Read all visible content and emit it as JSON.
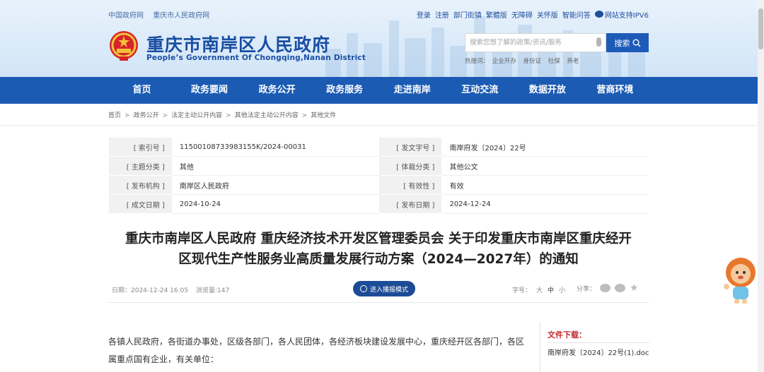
{
  "top_links": [
    "中国政府网",
    "重庆市人民政府网"
  ],
  "right_links": [
    "登录",
    "注册",
    "部门街镇",
    "繁體版",
    "无障碍",
    "关怀版",
    "智能问答",
    "网站支持IPV6"
  ],
  "site": {
    "title": "重庆市南岸区人民政府",
    "subtitle": "People’s Government Of Chongqing,Nanan District"
  },
  "search": {
    "placeholder": "搜索您想了解的政策/资讯/服务",
    "button_label": "搜索",
    "hot_label": "热搜词：",
    "hot_words": [
      "企业开办",
      "身份证",
      "社保",
      "养老"
    ]
  },
  "nav": [
    "首页",
    "政务要闻",
    "政务公开",
    "政务服务",
    "走进南岸",
    "互动交流",
    "数据开放",
    "营商环境"
  ],
  "breadcrumb": [
    "首页",
    "政务公开",
    "法定主动公开内容",
    "其他法定主动公开内容",
    "其他文件"
  ],
  "info": [
    {
      "k1": "[ 索引号 ]",
      "v1": "11500108733983155K/2024-00031",
      "k2": "[ 发文字号 ]",
      "v2": "南岸府发〔2024〕22号"
    },
    {
      "k1": "[ 主题分类 ]",
      "v1": "其他",
      "k2": "[ 体裁分类 ]",
      "v2": "其他公文"
    },
    {
      "k1": "[ 发布机构 ]",
      "v1": "南岸区人民政府",
      "k2": "[ 有效性 ]",
      "v2": "有效"
    },
    {
      "k1": "[ 成文日期 ]",
      "v1": "2024-10-24",
      "k2": "[ 发布日期 ]",
      "v2": "2024-12-24"
    }
  ],
  "doc": {
    "title_line1": "重庆市南岸区人民政府 重庆经济技术开发区管理委员会 关于印发重庆市南岸区重庆经开",
    "title_line2": "区现代生产性服务业高质量发展行动方案（2024—2027年）的通知",
    "date": "日期：2024-12-24 16:05",
    "views": "浏览量:147",
    "reader_button": "进入播报模式",
    "font_label": "字号：",
    "font_big": "大",
    "font_mid": "中",
    "font_small": "小",
    "share_label": "分享：",
    "body": "各镇人民政府，各街道办事处，区级各部门，各人民团体，各经济板块建设发展中心，重庆经开区各部门，各区属重点国有企业，有关单位："
  },
  "download": {
    "title": "文件下载：",
    "file": "南岸府发〔2024〕22号(1).doc"
  },
  "colors": {
    "brand_blue": "#1b5bb3",
    "title_blue": "#1a4ea3",
    "download_red": "#c0282d"
  }
}
